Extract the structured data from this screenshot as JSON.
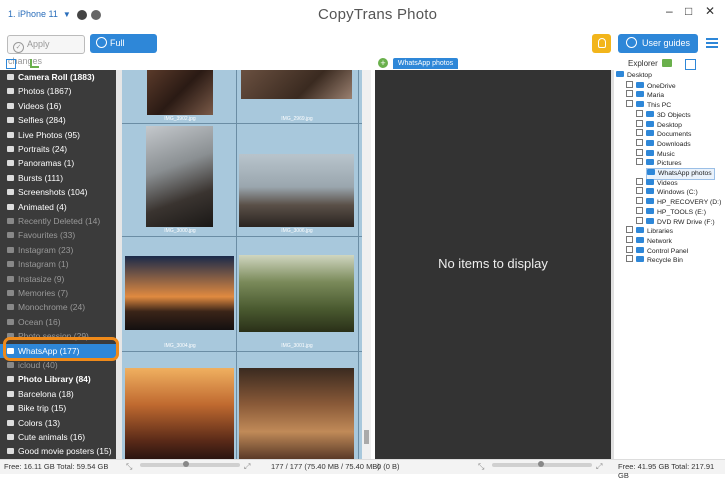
{
  "window": {
    "device": "1. iPhone 11",
    "title": "CopyTrans Photo"
  },
  "toolbar": {
    "apply_label": "Apply changes",
    "backup_label": "Full Backup",
    "guides_label": "User guides"
  },
  "left_panel": {
    "items": [
      {
        "label": "Camera Roll (1883)",
        "header": true
      },
      {
        "label": "Photos (1867)"
      },
      {
        "label": "Videos (16)"
      },
      {
        "label": "Selfies (284)"
      },
      {
        "label": "Live Photos (95)"
      },
      {
        "label": "Portraits (24)"
      },
      {
        "label": "Panoramas (1)"
      },
      {
        "label": "Bursts (111)"
      },
      {
        "label": "Screenshots (104)"
      },
      {
        "label": "Animated (4)"
      },
      {
        "label": "Recently Deleted (14)",
        "dim": true
      },
      {
        "label": "Favourites (33)",
        "dim": true
      },
      {
        "label": "Instagram (23)",
        "dim": true
      },
      {
        "label": "Instagram (1)",
        "dim": true
      },
      {
        "label": "Instasize (9)",
        "dim": true
      },
      {
        "label": "Memories (7)",
        "dim": true
      },
      {
        "label": "Monochrome (24)",
        "dim": true
      },
      {
        "label": "Ocean (16)",
        "dim": true
      },
      {
        "label": "Photo session (29)",
        "dim": true
      },
      {
        "label": "WhatsApp (177)",
        "selected": true
      },
      {
        "label": "icloud (40)",
        "dim": true
      },
      {
        "label": "Photo Library (84)",
        "header": true
      },
      {
        "label": "Barcelona (18)"
      },
      {
        "label": "Bike trip (15)"
      },
      {
        "label": "Colors (13)"
      },
      {
        "label": "Cute animals (16)"
      },
      {
        "label": "Good movie posters (15)"
      }
    ]
  },
  "grid": {
    "captions": [
      "IMG_3902.jpg",
      "IMG_2969.jpg",
      "IMG_3000.jpg",
      "IMG_3006.jpg",
      "IMG_3004.jpg",
      "IMG_3001.jpg"
    ]
  },
  "middle": {
    "tab_label": "WhatsApp photos (0)",
    "empty_message": "No items to display"
  },
  "explorer": {
    "label": "Explorer",
    "tree": [
      {
        "label": "Desktop",
        "indent": 0
      },
      {
        "label": "OneDrive",
        "indent": 1
      },
      {
        "label": "Maria",
        "indent": 1
      },
      {
        "label": "This PC",
        "indent": 1
      },
      {
        "label": "3D Objects",
        "indent": 2
      },
      {
        "label": "Desktop",
        "indent": 2
      },
      {
        "label": "Documents",
        "indent": 2
      },
      {
        "label": "Downloads",
        "indent": 2
      },
      {
        "label": "Music",
        "indent": 2
      },
      {
        "label": "Pictures",
        "indent": 2
      },
      {
        "label": "WhatsApp photos",
        "indent": 3,
        "selected": true
      },
      {
        "label": "Videos",
        "indent": 2
      },
      {
        "label": "Windows (C:)",
        "indent": 2
      },
      {
        "label": "HP_RECOVERY (D:)",
        "indent": 2
      },
      {
        "label": "HP_TOOLS (E:)",
        "indent": 2
      },
      {
        "label": "DVD RW Drive (F:)",
        "indent": 2
      },
      {
        "label": "Libraries",
        "indent": 1
      },
      {
        "label": "Network",
        "indent": 1
      },
      {
        "label": "Control Panel",
        "indent": 1
      },
      {
        "label": "Recycle Bin",
        "indent": 1
      }
    ]
  },
  "status": {
    "left_free": "Free: 16.11 GB Total: 59.54 GB",
    "grid_count": "177 / 177 (75.40 MB / 75.40 MB)",
    "mid_count": "0 (0 B)",
    "right_free": "Free: 41.95 GB Total: 217.91 GB"
  }
}
